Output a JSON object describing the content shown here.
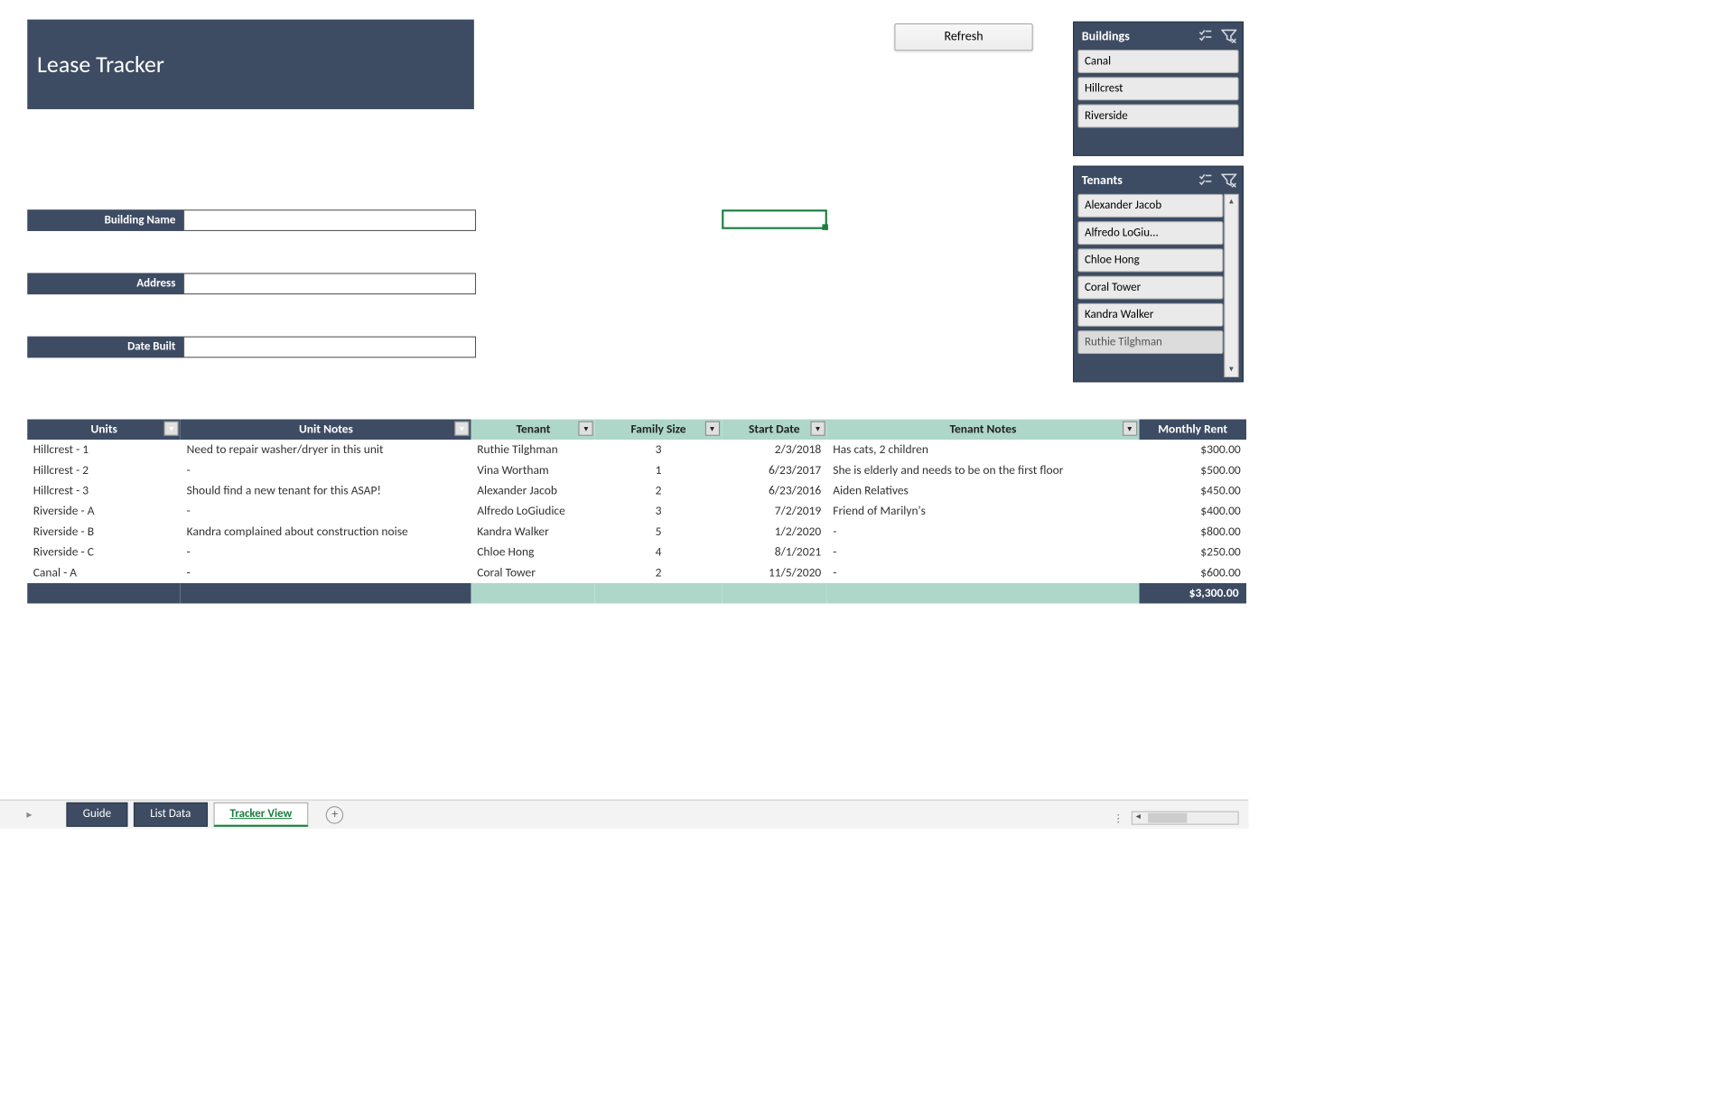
{
  "title": "Lease Tracker",
  "refresh_label": "Refresh",
  "form": {
    "building_label": "Building Name",
    "address_label": "Address",
    "date_built_label": "Date Built"
  },
  "slicers": {
    "buildings": {
      "title": "Buildings",
      "items": [
        "Canal",
        "Hillcrest",
        "Riverside"
      ]
    },
    "tenants": {
      "title": "Tenants",
      "items": [
        "Alexander Jacob",
        "Alfredo LoGiu...",
        "Chloe Hong",
        "Coral Tower",
        "Kandra Walker",
        "Ruthie Tilghman"
      ]
    }
  },
  "table": {
    "headers": {
      "units": "Units",
      "unit_notes": "Unit Notes",
      "tenant": "Tenant",
      "family_size": "Family Size",
      "start_date": "Start Date",
      "tenant_notes": "Tenant Notes",
      "monthly_rent": "Monthly Rent"
    },
    "rows": [
      {
        "units": "Hillcrest - 1",
        "unit_notes": "Need to repair washer/dryer in this unit",
        "tenant": "Ruthie Tilghman",
        "family_size": "3",
        "start_date": "2/3/2018",
        "tenant_notes": "Has cats, 2 children",
        "monthly_rent": "$300.00"
      },
      {
        "units": "Hillcrest - 2",
        "unit_notes": "-",
        "tenant": "Vina Wortham",
        "family_size": "1",
        "start_date": "6/23/2017",
        "tenant_notes": "She is elderly and needs to be on the first floor",
        "monthly_rent": "$500.00"
      },
      {
        "units": "Hillcrest - 3",
        "unit_notes": "Should find a new tenant for this ASAP!",
        "tenant": "Alexander Jacob",
        "family_size": "2",
        "start_date": "6/23/2016",
        "tenant_notes": "Aiden Relatives",
        "monthly_rent": "$450.00"
      },
      {
        "units": "Riverside - A",
        "unit_notes": "-",
        "tenant": "Alfredo LoGiudice",
        "family_size": "3",
        "start_date": "7/2/2019",
        "tenant_notes": "Friend of Marilyn's",
        "monthly_rent": "$400.00"
      },
      {
        "units": "Riverside - B",
        "unit_notes": "Kandra complained about construction noise",
        "tenant": "Kandra Walker",
        "family_size": "5",
        "start_date": "1/2/2020",
        "tenant_notes": "-",
        "monthly_rent": "$800.00"
      },
      {
        "units": "Riverside - C",
        "unit_notes": "-",
        "tenant": "Chloe Hong",
        "family_size": "4",
        "start_date": "8/1/2021",
        "tenant_notes": "-",
        "monthly_rent": "$250.00"
      },
      {
        "units": "Canal - A",
        "unit_notes": "-",
        "tenant": "Coral Tower",
        "family_size": "2",
        "start_date": "11/5/2020",
        "tenant_notes": "-",
        "monthly_rent": "$600.00"
      }
    ],
    "total_rent": "$3,300.00"
  },
  "sheets": {
    "guide": "Guide",
    "list_data": "List Data",
    "tracker_view": "Tracker View"
  }
}
